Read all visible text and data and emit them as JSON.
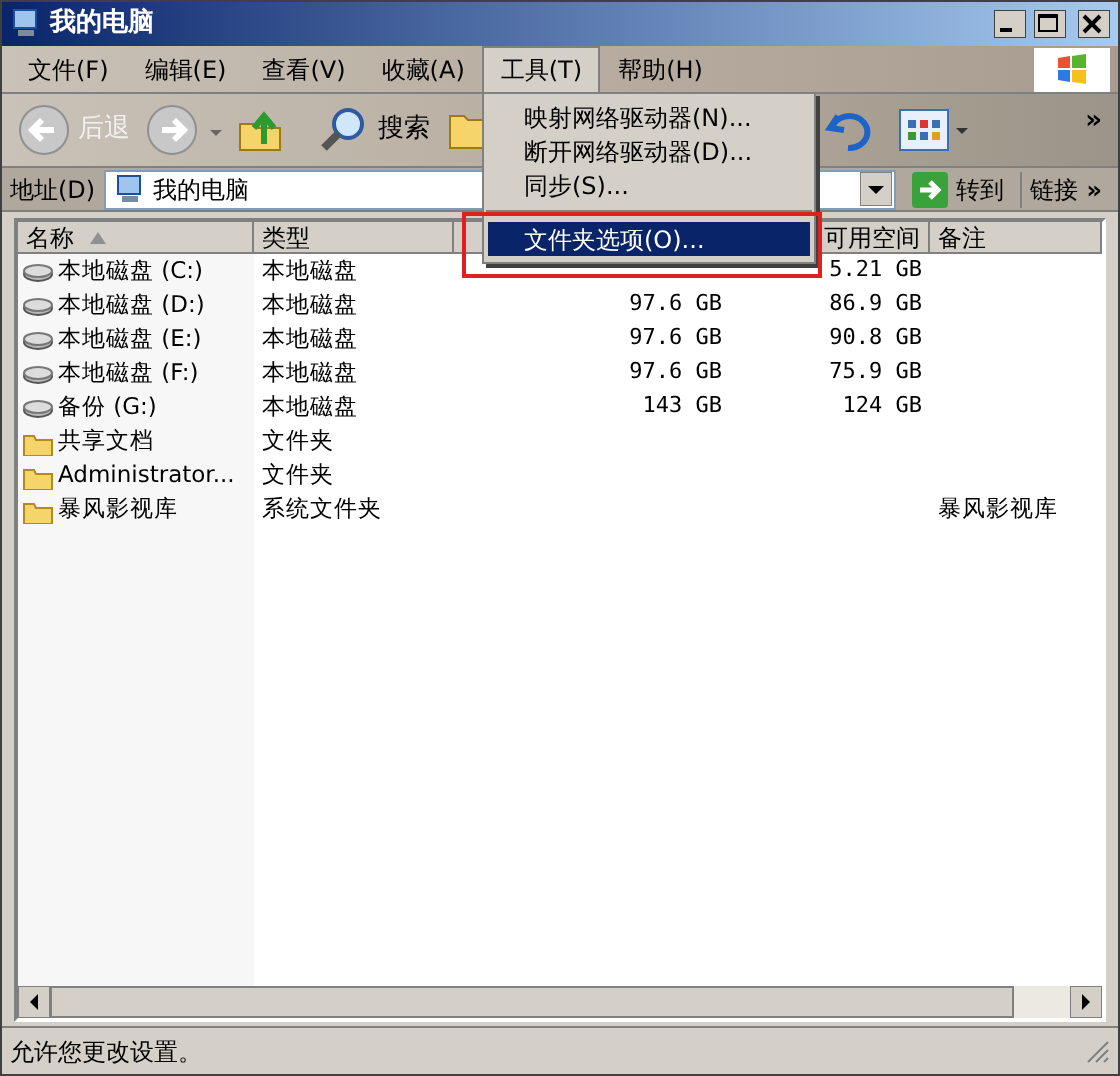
{
  "window": {
    "title": "我的电脑"
  },
  "menu_bar": [
    {
      "label": "文件(F)",
      "selected": false
    },
    {
      "label": "编辑(E)",
      "selected": false
    },
    {
      "label": "查看(V)",
      "selected": false
    },
    {
      "label": "收藏(A)",
      "selected": false
    },
    {
      "label": "工具(T)",
      "selected": true
    },
    {
      "label": "帮助(H)",
      "selected": false
    }
  ],
  "toolbar": {
    "back": "后退",
    "search": "搜索",
    "more": "»"
  },
  "address_bar": {
    "label": "地址(D)",
    "value": "我的电脑",
    "go": "转到",
    "links": "链接",
    "links_more": "»"
  },
  "tools_menu": [
    {
      "label": "映射网络驱动器(N)...",
      "selected": false,
      "separator_before": false
    },
    {
      "label": "断开网络驱动器(D)...",
      "selected": false,
      "separator_before": false
    },
    {
      "label": "同步(S)...",
      "selected": false,
      "separator_before": false
    },
    {
      "label": "文件夹选项(O)...",
      "selected": true,
      "separator_before": true
    }
  ],
  "table": {
    "columns": [
      {
        "label": "名称",
        "sorted": true
      },
      {
        "label": "类型",
        "sorted": false
      },
      {
        "sorted": false
      },
      {
        "label": "可用空间",
        "sorted": false
      },
      {
        "label": "备注",
        "sorted": false
      }
    ],
    "rows": [
      {
        "kind": "drive",
        "name": "本地磁盘 (C:)",
        "type": "本地磁盘",
        "free": "5.21 GB"
      },
      {
        "kind": "drive",
        "name": "本地磁盘 (D:)",
        "type": "本地磁盘",
        "total": "97.6 GB",
        "free": "86.9 GB"
      },
      {
        "kind": "drive",
        "name": "本地磁盘 (E:)",
        "type": "本地磁盘",
        "total": "97.6 GB",
        "free": "90.8 GB"
      },
      {
        "kind": "drive",
        "name": "本地磁盘 (F:)",
        "type": "本地磁盘",
        "total": "97.6 GB",
        "free": "75.9 GB"
      },
      {
        "kind": "drive",
        "name": "备份 (G:)",
        "type": "本地磁盘",
        "total": "143 GB",
        "free": "124 GB"
      },
      {
        "kind": "folder",
        "name": "共享文档",
        "type": "文件夹"
      },
      {
        "kind": "folder",
        "name": "Administrator...",
        "type": "文件夹"
      },
      {
        "kind": "folder",
        "name": "暴风影视库",
        "type": "系统文件夹",
        "note": "暴风影视库"
      }
    ]
  },
  "status_bar": {
    "text": "允许您更改设置。"
  }
}
